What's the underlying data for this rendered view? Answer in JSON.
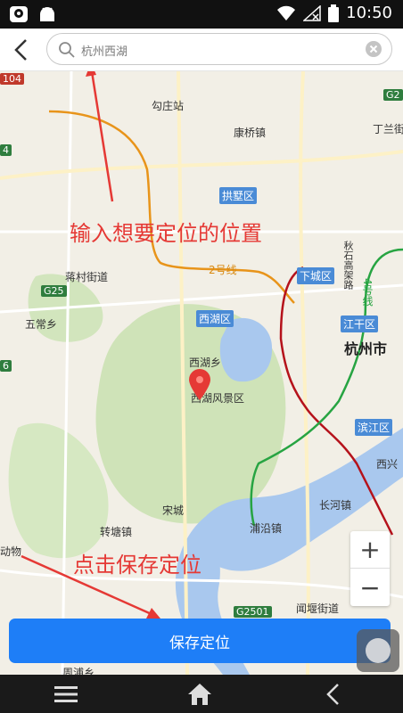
{
  "status_bar": {
    "time": "10:50",
    "left_icons": [
      "app-notification-icon",
      "android-icon"
    ],
    "right_icons": [
      "wifi-icon",
      "no-signal-icon",
      "battery-icon"
    ]
  },
  "search": {
    "text": "杭州西湖"
  },
  "map": {
    "labels": {
      "gouzhuang": "勾庄站",
      "kangqiao": "康桥镇",
      "dinglan": "丁兰街",
      "jiangcun": "蒋村街道",
      "wuchang": "五常乡",
      "xihuxiang": "西湖乡",
      "xihu_scenic": "西湖风景区",
      "songcheng": "宋城",
      "zhuanqiao": "转塘镇",
      "puyan": "浦沿镇",
      "changhe": "长河镇",
      "xixing": "西兴",
      "wenyan": "闻堰街道",
      "bottom_left": "动物",
      "bottom_partial": "周浦乡",
      "metro_line2": "2号线",
      "metro_line4": "4号线",
      "qiushi": "秋石高架路",
      "road_g25": "G25",
      "road_104": "104",
      "road_g2": "G2",
      "road_g2501": "G2501",
      "edge_4": "4",
      "edge_6": "6"
    },
    "districts": {
      "gongshu": "拱墅区",
      "xiacheng": "下城区",
      "xihu": "西湖区",
      "jianggan": "江干区",
      "binjiang": "滨江区"
    },
    "city": "杭州市",
    "annotations": {
      "input_hint": "输入想要定位的位置",
      "click_hint": "点击保存定位"
    },
    "annotation_color": "#e53935",
    "marker_color": "#e53935"
  },
  "zoom": {
    "in": "+",
    "out": "−"
  },
  "save_button": {
    "label": "保存定位",
    "color": "#1e7ef7"
  },
  "nav_bar": {
    "icons": [
      "menu-icon",
      "home-icon",
      "back-icon"
    ]
  }
}
